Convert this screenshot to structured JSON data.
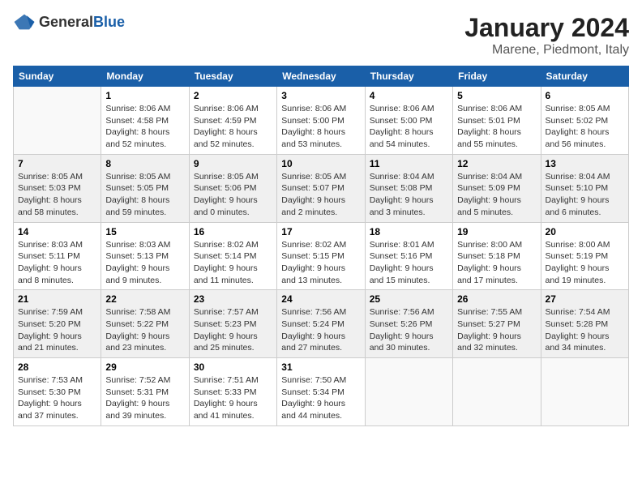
{
  "header": {
    "logo_general": "General",
    "logo_blue": "Blue",
    "month": "January 2024",
    "location": "Marene, Piedmont, Italy"
  },
  "weekdays": [
    "Sunday",
    "Monday",
    "Tuesday",
    "Wednesday",
    "Thursday",
    "Friday",
    "Saturday"
  ],
  "weeks": [
    [
      {
        "day": "",
        "sunrise": "",
        "sunset": "",
        "daylight": ""
      },
      {
        "day": "1",
        "sunrise": "Sunrise: 8:06 AM",
        "sunset": "Sunset: 4:58 PM",
        "daylight": "Daylight: 8 hours and 52 minutes."
      },
      {
        "day": "2",
        "sunrise": "Sunrise: 8:06 AM",
        "sunset": "Sunset: 4:59 PM",
        "daylight": "Daylight: 8 hours and 52 minutes."
      },
      {
        "day": "3",
        "sunrise": "Sunrise: 8:06 AM",
        "sunset": "Sunset: 5:00 PM",
        "daylight": "Daylight: 8 hours and 53 minutes."
      },
      {
        "day": "4",
        "sunrise": "Sunrise: 8:06 AM",
        "sunset": "Sunset: 5:00 PM",
        "daylight": "Daylight: 8 hours and 54 minutes."
      },
      {
        "day": "5",
        "sunrise": "Sunrise: 8:06 AM",
        "sunset": "Sunset: 5:01 PM",
        "daylight": "Daylight: 8 hours and 55 minutes."
      },
      {
        "day": "6",
        "sunrise": "Sunrise: 8:05 AM",
        "sunset": "Sunset: 5:02 PM",
        "daylight": "Daylight: 8 hours and 56 minutes."
      }
    ],
    [
      {
        "day": "7",
        "sunrise": "Sunrise: 8:05 AM",
        "sunset": "Sunset: 5:03 PM",
        "daylight": "Daylight: 8 hours and 58 minutes."
      },
      {
        "day": "8",
        "sunrise": "Sunrise: 8:05 AM",
        "sunset": "Sunset: 5:05 PM",
        "daylight": "Daylight: 8 hours and 59 minutes."
      },
      {
        "day": "9",
        "sunrise": "Sunrise: 8:05 AM",
        "sunset": "Sunset: 5:06 PM",
        "daylight": "Daylight: 9 hours and 0 minutes."
      },
      {
        "day": "10",
        "sunrise": "Sunrise: 8:05 AM",
        "sunset": "Sunset: 5:07 PM",
        "daylight": "Daylight: 9 hours and 2 minutes."
      },
      {
        "day": "11",
        "sunrise": "Sunrise: 8:04 AM",
        "sunset": "Sunset: 5:08 PM",
        "daylight": "Daylight: 9 hours and 3 minutes."
      },
      {
        "day": "12",
        "sunrise": "Sunrise: 8:04 AM",
        "sunset": "Sunset: 5:09 PM",
        "daylight": "Daylight: 9 hours and 5 minutes."
      },
      {
        "day": "13",
        "sunrise": "Sunrise: 8:04 AM",
        "sunset": "Sunset: 5:10 PM",
        "daylight": "Daylight: 9 hours and 6 minutes."
      }
    ],
    [
      {
        "day": "14",
        "sunrise": "Sunrise: 8:03 AM",
        "sunset": "Sunset: 5:11 PM",
        "daylight": "Daylight: 9 hours and 8 minutes."
      },
      {
        "day": "15",
        "sunrise": "Sunrise: 8:03 AM",
        "sunset": "Sunset: 5:13 PM",
        "daylight": "Daylight: 9 hours and 9 minutes."
      },
      {
        "day": "16",
        "sunrise": "Sunrise: 8:02 AM",
        "sunset": "Sunset: 5:14 PM",
        "daylight": "Daylight: 9 hours and 11 minutes."
      },
      {
        "day": "17",
        "sunrise": "Sunrise: 8:02 AM",
        "sunset": "Sunset: 5:15 PM",
        "daylight": "Daylight: 9 hours and 13 minutes."
      },
      {
        "day": "18",
        "sunrise": "Sunrise: 8:01 AM",
        "sunset": "Sunset: 5:16 PM",
        "daylight": "Daylight: 9 hours and 15 minutes."
      },
      {
        "day": "19",
        "sunrise": "Sunrise: 8:00 AM",
        "sunset": "Sunset: 5:18 PM",
        "daylight": "Daylight: 9 hours and 17 minutes."
      },
      {
        "day": "20",
        "sunrise": "Sunrise: 8:00 AM",
        "sunset": "Sunset: 5:19 PM",
        "daylight": "Daylight: 9 hours and 19 minutes."
      }
    ],
    [
      {
        "day": "21",
        "sunrise": "Sunrise: 7:59 AM",
        "sunset": "Sunset: 5:20 PM",
        "daylight": "Daylight: 9 hours and 21 minutes."
      },
      {
        "day": "22",
        "sunrise": "Sunrise: 7:58 AM",
        "sunset": "Sunset: 5:22 PM",
        "daylight": "Daylight: 9 hours and 23 minutes."
      },
      {
        "day": "23",
        "sunrise": "Sunrise: 7:57 AM",
        "sunset": "Sunset: 5:23 PM",
        "daylight": "Daylight: 9 hours and 25 minutes."
      },
      {
        "day": "24",
        "sunrise": "Sunrise: 7:56 AM",
        "sunset": "Sunset: 5:24 PM",
        "daylight": "Daylight: 9 hours and 27 minutes."
      },
      {
        "day": "25",
        "sunrise": "Sunrise: 7:56 AM",
        "sunset": "Sunset: 5:26 PM",
        "daylight": "Daylight: 9 hours and 30 minutes."
      },
      {
        "day": "26",
        "sunrise": "Sunrise: 7:55 AM",
        "sunset": "Sunset: 5:27 PM",
        "daylight": "Daylight: 9 hours and 32 minutes."
      },
      {
        "day": "27",
        "sunrise": "Sunrise: 7:54 AM",
        "sunset": "Sunset: 5:28 PM",
        "daylight": "Daylight: 9 hours and 34 minutes."
      }
    ],
    [
      {
        "day": "28",
        "sunrise": "Sunrise: 7:53 AM",
        "sunset": "Sunset: 5:30 PM",
        "daylight": "Daylight: 9 hours and 37 minutes."
      },
      {
        "day": "29",
        "sunrise": "Sunrise: 7:52 AM",
        "sunset": "Sunset: 5:31 PM",
        "daylight": "Daylight: 9 hours and 39 minutes."
      },
      {
        "day": "30",
        "sunrise": "Sunrise: 7:51 AM",
        "sunset": "Sunset: 5:33 PM",
        "daylight": "Daylight: 9 hours and 41 minutes."
      },
      {
        "day": "31",
        "sunrise": "Sunrise: 7:50 AM",
        "sunset": "Sunset: 5:34 PM",
        "daylight": "Daylight: 9 hours and 44 minutes."
      },
      {
        "day": "",
        "sunrise": "",
        "sunset": "",
        "daylight": ""
      },
      {
        "day": "",
        "sunrise": "",
        "sunset": "",
        "daylight": ""
      },
      {
        "day": "",
        "sunrise": "",
        "sunset": "",
        "daylight": ""
      }
    ]
  ]
}
